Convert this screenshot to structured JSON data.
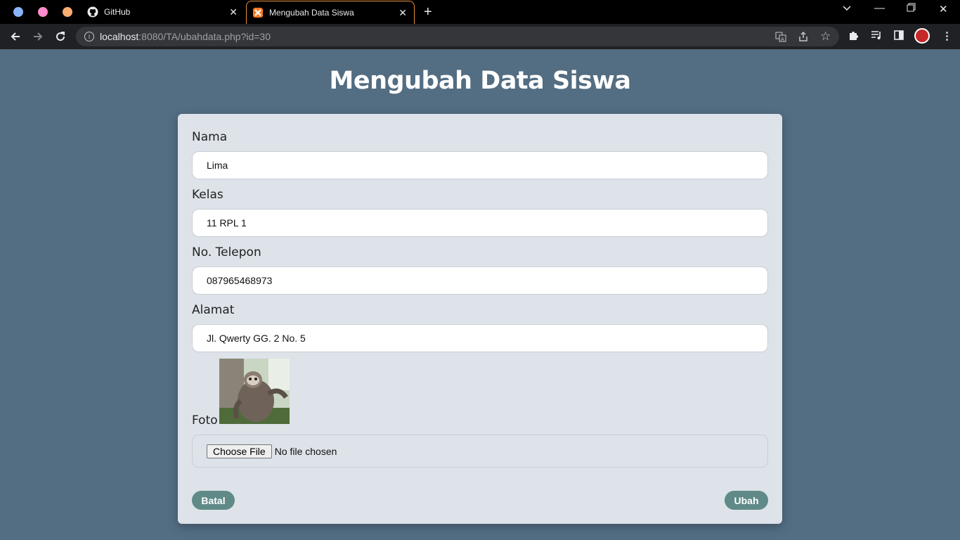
{
  "browser": {
    "tabs": [
      {
        "title": "GitHub",
        "active": false
      },
      {
        "title": "Mengubah Data Siswa",
        "active": true
      }
    ],
    "url_host": "localhost",
    "url_rest": ":8080/TA/ubahdata.php?id=30",
    "accent": "#e8913c"
  },
  "page": {
    "title": "Mengubah Data Siswa",
    "background": "#536d82"
  },
  "form": {
    "nama_label": "Nama",
    "nama_value": "Lima",
    "kelas_label": "Kelas",
    "kelas_value": "11 RPL 1",
    "telepon_label": "No. Telepon",
    "telepon_value": "087965468973",
    "alamat_label": "Alamat",
    "alamat_value": "Jl. Qwerty GG. 2 No. 5",
    "foto_label": "Foto",
    "choose_file_label": "Choose File",
    "no_file_text": "No file chosen",
    "batal_label": "Batal",
    "ubah_label": "Ubah",
    "button_color": "#5f8a87"
  }
}
